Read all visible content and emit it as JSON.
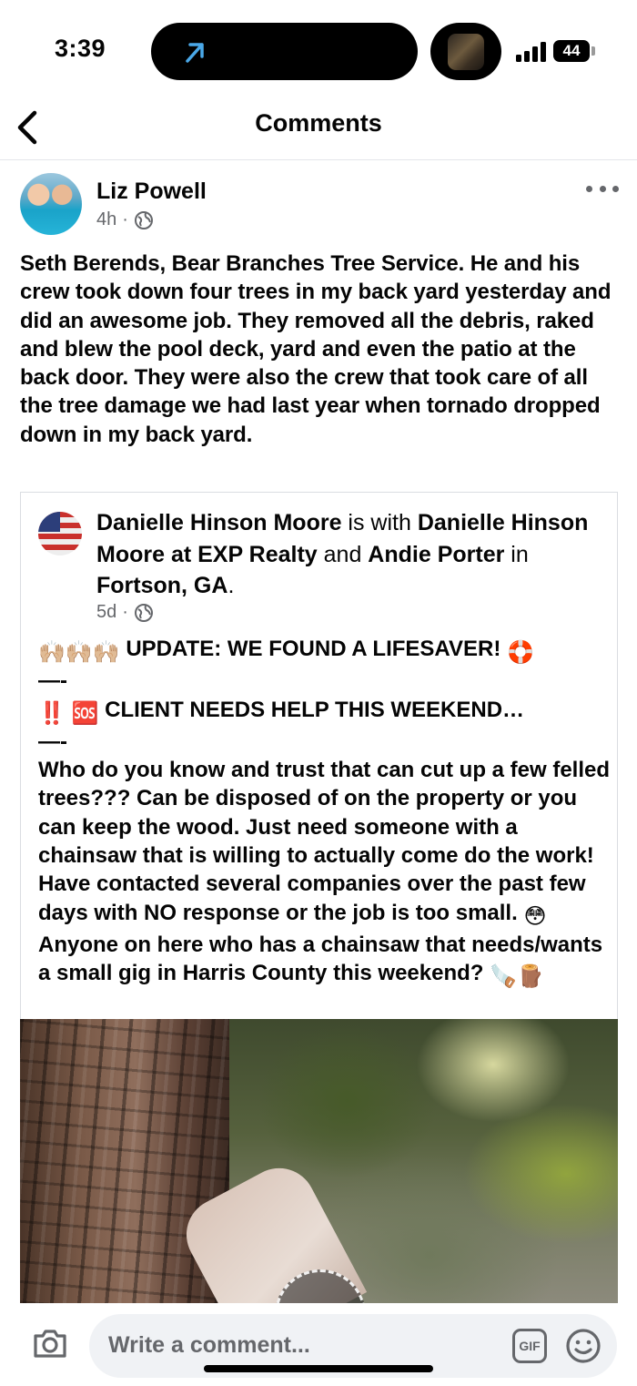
{
  "status_bar": {
    "time": "3:39",
    "battery": "44"
  },
  "header": {
    "title": "Comments"
  },
  "post": {
    "author": "Liz Powell",
    "time": "4h",
    "separator": "·",
    "text": "Seth Berends, Bear Branches Tree Service.  He and his crew took down four trees in my back yard yesterday and did an awesome job.  They removed all the debris, raked and blew the pool deck, yard and even the patio at the back door.  They were also the crew that took care of all the tree damage we had last year when tornado dropped down in my back yard."
  },
  "shared_post": {
    "author": "Danielle Hinson Moore",
    "with_text": " is with ",
    "tagged_1": "Danielle Hinson Moore at EXP Realty",
    "and_text": " and ",
    "tagged_2": "Andie Porter",
    "in_text": " in ",
    "location": "Fortson, GA",
    "period": ".",
    "time": "5d",
    "separator": "·",
    "line_1_emoji": "🙌🏼🙌🏼🙌🏼",
    "line_1": " UPDATE: WE FOUND A LIFESAVER! ",
    "line_1_end": "🛟",
    "dash_1": "—-",
    "line_2_emoji": "‼️ 🆘",
    "line_2": " CLIENT NEEDS HELP THIS WEEKEND…",
    "dash_2": "—-",
    "body": "Who do you know and trust that can cut up a few felled trees??? Can be disposed of on the property or you can keep the wood. Just need someone with a chainsaw that is willing to actually come do the work! Have contacted several companies over the past few days with NO response or the job is too small. ",
    "body_emoji": "😳",
    "body_2": " Anyone on here who has a chainsaw that needs/wants a small gig in Harris County this weekend? ",
    "body_end_emoji": "🪚🪵"
  },
  "comment_bar": {
    "placeholder": "Write a comment...",
    "gif_label": "GIF"
  },
  "icons": {
    "back": "chevron-left-icon",
    "more": "more-horizontal-icon",
    "globe": "globe-icon",
    "camera": "camera-icon",
    "gif": "gif-icon",
    "emoji": "smiley-icon"
  }
}
